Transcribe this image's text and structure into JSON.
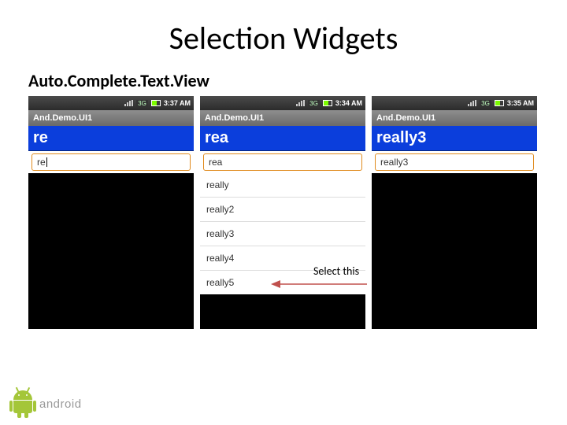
{
  "slide": {
    "title": "Selection Widgets",
    "subtitle": "Auto.Complete.Text.View"
  },
  "annotation": {
    "text": "Select this"
  },
  "logo": {
    "wordmark": "android"
  },
  "phones": {
    "p1": {
      "time": "3:37 AM",
      "netBadge": "3G",
      "appTitle": "And.Demo.UI1",
      "label": "re",
      "inputValue": "re"
    },
    "p2": {
      "time": "3:34 AM",
      "netBadge": "3G",
      "appTitle": "And.Demo.UI1",
      "label": "rea",
      "inputValue": "rea",
      "options": [
        "really",
        "really2",
        "really3",
        "really4",
        "really5"
      ]
    },
    "p3": {
      "time": "3:35 AM",
      "netBadge": "3G",
      "appTitle": "And.Demo.UI1",
      "label": "really3",
      "inputValue": "really3"
    }
  }
}
